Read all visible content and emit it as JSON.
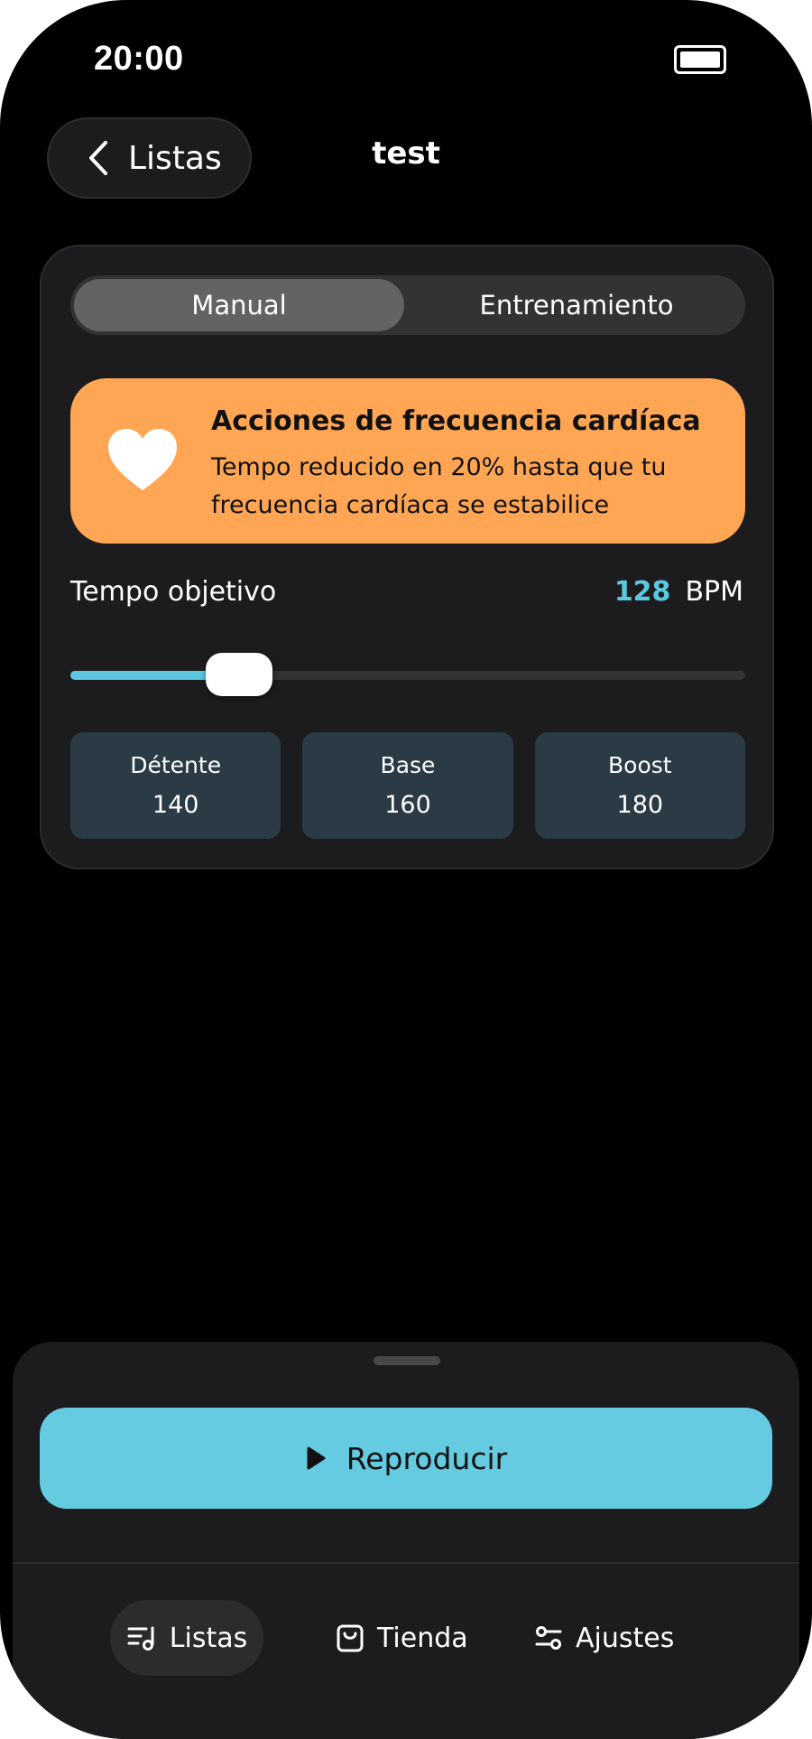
{
  "status_bar": {
    "time": "20:00",
    "icons": [
      "battery-icon"
    ]
  },
  "header": {
    "back_label": "Listas",
    "title": "test"
  },
  "mode_tabs": [
    {
      "label": "Manual",
      "active": true
    },
    {
      "label": "Entrenamiento",
      "active": false
    }
  ],
  "heart_rate_alert": {
    "icon": "heart-icon",
    "title": "Acciones de frecuencia cardíaca",
    "body": "Tempo reducido en 20% hasta que tu frecuencia cardíaca se estabilice",
    "color": "#ffa654"
  },
  "tempo": {
    "label": "Tempo objetivo",
    "value": "128",
    "unit": "BPM",
    "slider_fraction": 0.25,
    "accent_color": "#5cc8e0"
  },
  "presets": [
    {
      "name": "Détente",
      "value": "140"
    },
    {
      "name": "Base",
      "value": "160"
    },
    {
      "name": "Boost",
      "value": "180"
    }
  ],
  "player": {
    "play_label": "Reproducir",
    "icon": "play-icon",
    "button_color": "#64cbe0"
  },
  "tab_bar": [
    {
      "label": "Listas",
      "icon": "playlist-icon",
      "active": true
    },
    {
      "label": "Tienda",
      "icon": "shopping-bag-icon",
      "active": false
    },
    {
      "label": "Ajustes",
      "icon": "sliders-icon",
      "active": false
    }
  ]
}
